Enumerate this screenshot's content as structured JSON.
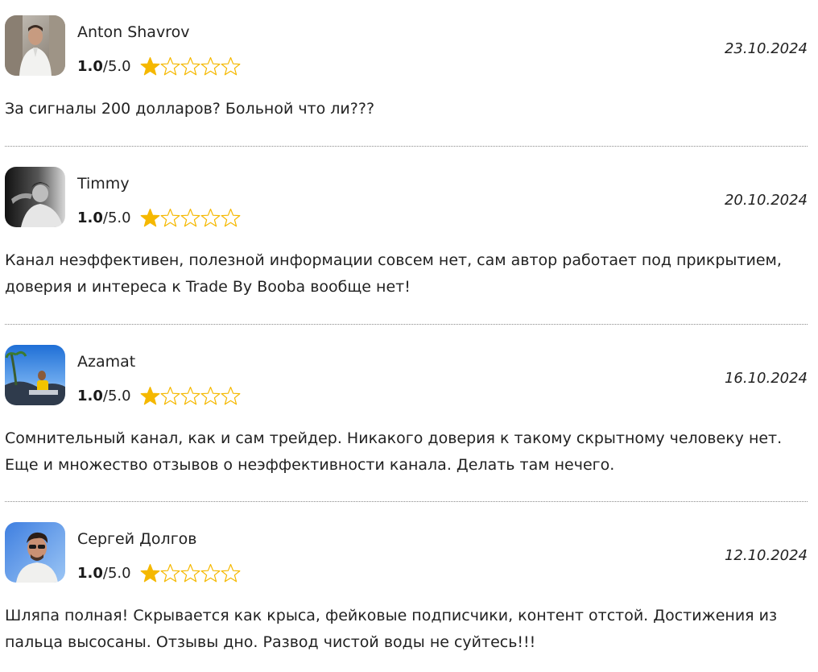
{
  "reviews": [
    {
      "author": "Anton Shavrov",
      "score": "1.0",
      "max": "/5.0",
      "stars_filled": 1,
      "stars_total": 5,
      "date": "23.10.2024",
      "text": "За сигналы 200 долларов? Больной что ли???"
    },
    {
      "author": "Timmy",
      "score": "1.0",
      "max": "/5.0",
      "stars_filled": 1,
      "stars_total": 5,
      "date": "20.10.2024",
      "text": "Канал неэффективен, полезной информации совсем нет, сам автор работает под прикрытием, доверия и интереса к Trade By Booba вообще нет!"
    },
    {
      "author": "Azamat",
      "score": "1.0",
      "max": "/5.0",
      "stars_filled": 1,
      "stars_total": 5,
      "date": "16.10.2024",
      "text": "Сомнительный канал, как и сам трейдер. Никакого доверия к такому скрытному человеку нет. Еще и множество отзывов о неэффективности канала. Делать там нечего."
    },
    {
      "author": "Сергей Долгов",
      "score": "1.0",
      "max": "/5.0",
      "stars_filled": 1,
      "stars_total": 5,
      "date": "12.10.2024",
      "text": "Шляпа полная! Скрывается как крыса, фейковые подписчики, контент отстой. Достижения из пальца высосаны. Отзывы дно. Развод чистой воды не суйтесь!!!"
    }
  ],
  "colors": {
    "star_fill": "#f5b800",
    "star_outline": "#f5b800",
    "divider": "#8a8a8a",
    "text": "#222222"
  },
  "icons": {
    "star_filled": "star-filled-icon",
    "star_empty": "star-empty-icon"
  }
}
